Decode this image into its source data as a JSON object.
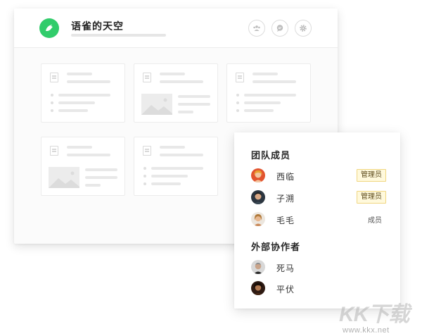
{
  "app": {
    "title": "语雀的天空",
    "logo_icon": "bird-icon",
    "logo_color": "#31cc6b"
  },
  "header_actions": [
    {
      "icon": "team-icon"
    },
    {
      "icon": "comment-icon"
    },
    {
      "icon": "settings-icon"
    }
  ],
  "members_panel": {
    "team_section_title": "团队成员",
    "team_members": [
      {
        "name": "西临",
        "role": "管理员",
        "role_style": "badge"
      },
      {
        "name": "子溯",
        "role": "管理员",
        "role_style": "badge"
      },
      {
        "name": "毛毛",
        "role": "成员",
        "role_style": "plain"
      }
    ],
    "collab_section_title": "外部协作者",
    "collaborators": [
      {
        "name": "死马"
      },
      {
        "name": "平伏"
      }
    ]
  },
  "watermark": {
    "logo_text": "KK下载",
    "url": "www.kkx.net"
  },
  "colors": {
    "badge_bg": "#fff9dc",
    "badge_border": "#f0d680"
  }
}
